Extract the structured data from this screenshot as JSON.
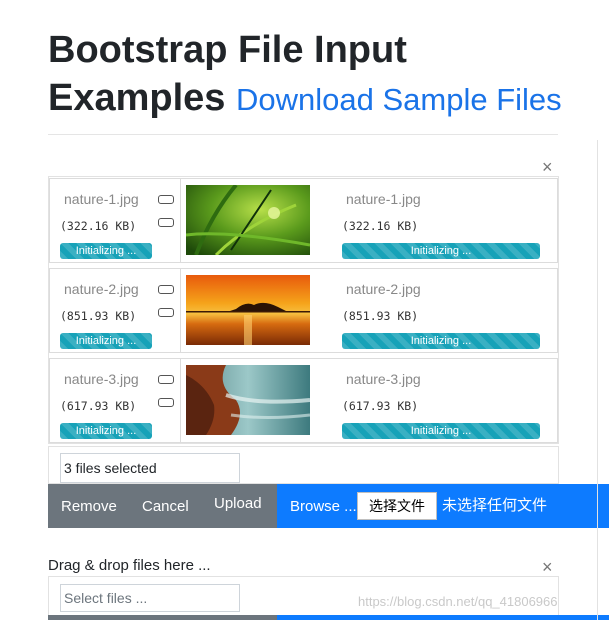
{
  "heading": {
    "line1": "Bootstrap File Input",
    "line2": "Examples",
    "link": "Download Sample Files"
  },
  "preview": {
    "close_icon": "×",
    "files": [
      {
        "name": "nature-1.jpg",
        "size": "(322.16 KB)",
        "status": "Initializing ...",
        "thumb": "grass"
      },
      {
        "name": "nature-2.jpg",
        "size": "(851.93 KB)",
        "status": "Initializing ...",
        "thumb": "sunset"
      },
      {
        "name": "nature-3.jpg",
        "size": "(617.93 KB)",
        "status": "Initializing ...",
        "thumb": "coast"
      }
    ]
  },
  "input1": {
    "caption": "3 files selected",
    "remove_label": "Remove",
    "cancel_label": "Cancel",
    "upload_label": "Upload",
    "browse_label": "Browse ...",
    "native_button": "选择文件",
    "native_status": "未选择任何文件"
  },
  "input2": {
    "label": "Drag & drop files here ...",
    "close_icon": "×",
    "placeholder": "Select files ..."
  },
  "watermark": "https://blog.csdn.net/qq_41806966",
  "colors": {
    "link": "#1a73e8",
    "secondary": "#6c757d",
    "primary": "#0d7bff",
    "progress": "#17a2b8"
  }
}
